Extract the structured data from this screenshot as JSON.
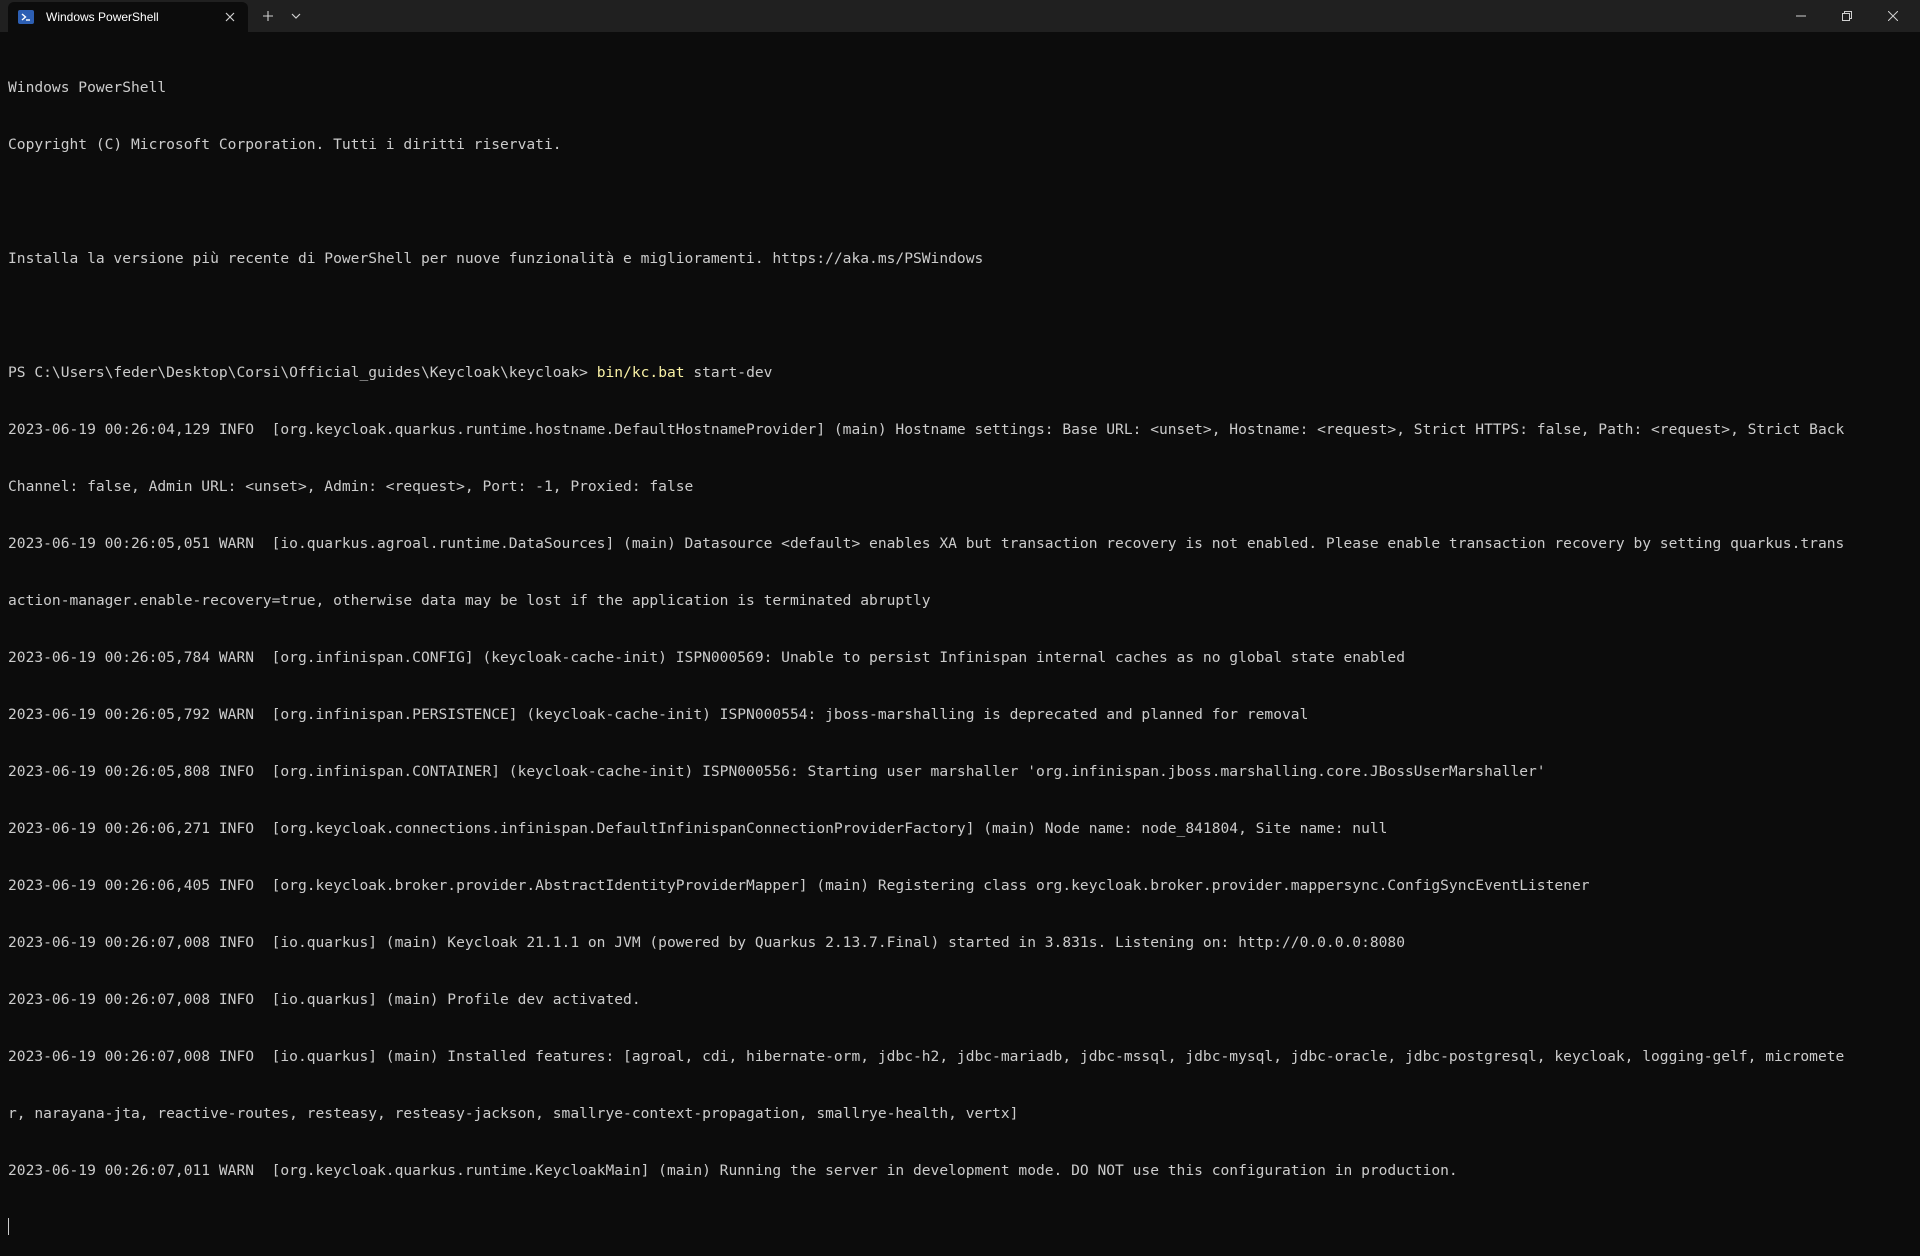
{
  "window": {
    "tab_title": "Windows PowerShell",
    "new_tab_label": "+",
    "icons": {
      "tab": "powershell-icon",
      "close_tab": "close-icon",
      "dropdown": "chevron-down-icon",
      "minimize": "minimize-icon",
      "maximize": "restore-icon",
      "close": "close-icon"
    }
  },
  "console": {
    "header": [
      "Windows PowerShell",
      "Copyright (C) Microsoft Corporation. Tutti i diritti riservati.",
      "",
      "Installa la versione più recente di PowerShell per nuove funzionalità e miglioramenti. https://aka.ms/PSWindows",
      ""
    ],
    "prompt": "PS C:\\Users\\feder\\Desktop\\Corsi\\Official_guides\\Keycloak\\keycloak> ",
    "command": "bin/kc.bat",
    "command_args": " start-dev",
    "log": [
      "2023-06-19 00:26:04,129 INFO  [org.keycloak.quarkus.runtime.hostname.DefaultHostnameProvider] (main) Hostname settings: Base URL: <unset>, Hostname: <request>, Strict HTTPS: false, Path: <request>, Strict Back",
      "Channel: false, Admin URL: <unset>, Admin: <request>, Port: -1, Proxied: false",
      "2023-06-19 00:26:05,051 WARN  [io.quarkus.agroal.runtime.DataSources] (main) Datasource <default> enables XA but transaction recovery is not enabled. Please enable transaction recovery by setting quarkus.trans",
      "action-manager.enable-recovery=true, otherwise data may be lost if the application is terminated abruptly",
      "2023-06-19 00:26:05,784 WARN  [org.infinispan.CONFIG] (keycloak-cache-init) ISPN000569: Unable to persist Infinispan internal caches as no global state enabled",
      "2023-06-19 00:26:05,792 WARN  [org.infinispan.PERSISTENCE] (keycloak-cache-init) ISPN000554: jboss-marshalling is deprecated and planned for removal",
      "2023-06-19 00:26:05,808 INFO  [org.infinispan.CONTAINER] (keycloak-cache-init) ISPN000556: Starting user marshaller 'org.infinispan.jboss.marshalling.core.JBossUserMarshaller'",
      "2023-06-19 00:26:06,271 INFO  [org.keycloak.connections.infinispan.DefaultInfinispanConnectionProviderFactory] (main) Node name: node_841804, Site name: null",
      "2023-06-19 00:26:06,405 INFO  [org.keycloak.broker.provider.AbstractIdentityProviderMapper] (main) Registering class org.keycloak.broker.provider.mappersync.ConfigSyncEventListener",
      "2023-06-19 00:26:07,008 INFO  [io.quarkus] (main) Keycloak 21.1.1 on JVM (powered by Quarkus 2.13.7.Final) started in 3.831s. Listening on: http://0.0.0.0:8080",
      "2023-06-19 00:26:07,008 INFO  [io.quarkus] (main) Profile dev activated.",
      "2023-06-19 00:26:07,008 INFO  [io.quarkus] (main) Installed features: [agroal, cdi, hibernate-orm, jdbc-h2, jdbc-mariadb, jdbc-mssql, jdbc-mysql, jdbc-oracle, jdbc-postgresql, keycloak, logging-gelf, micromete",
      "r, narayana-jta, reactive-routes, resteasy, resteasy-jackson, smallrye-context-propagation, smallrye-health, vertx]",
      "2023-06-19 00:26:07,011 WARN  [org.keycloak.quarkus.runtime.KeycloakMain] (main) Running the server in development mode. DO NOT use this configuration in production."
    ]
  }
}
